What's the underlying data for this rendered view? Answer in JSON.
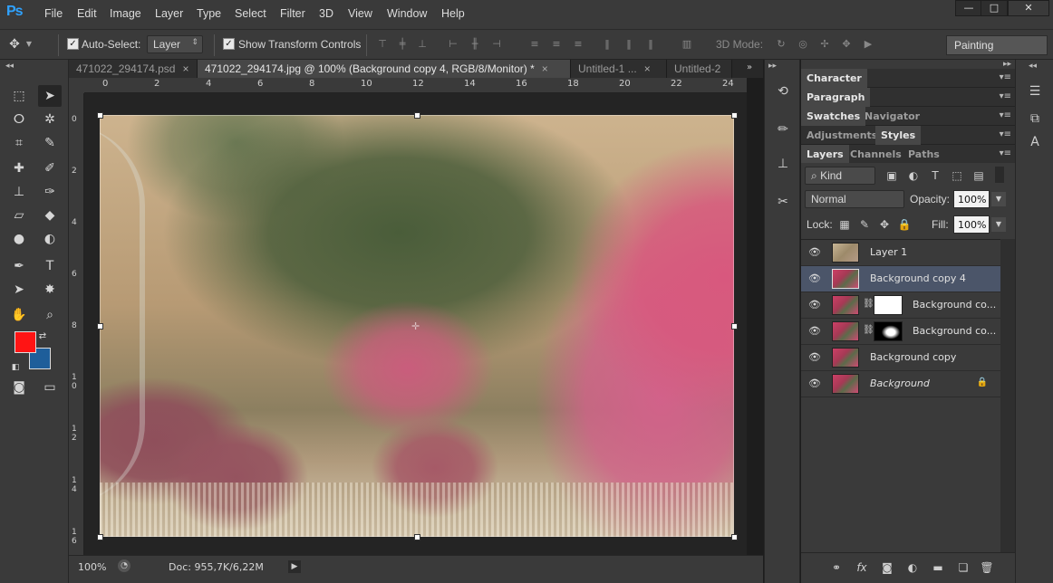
{
  "app": {
    "logo": "Ps"
  },
  "menu": [
    "File",
    "Edit",
    "Image",
    "Layer",
    "Type",
    "Select",
    "Filter",
    "3D",
    "View",
    "Window",
    "Help"
  ],
  "window_controls": {
    "minimize": "—",
    "maximize": "□",
    "close": "✕"
  },
  "options": {
    "auto_select_label": "Auto-Select:",
    "auto_select_checked": true,
    "auto_select_target": "Layer",
    "show_transform_label": "Show Transform Controls",
    "show_transform_checked": true,
    "mode_3d_label": "3D Mode:",
    "workspace": "Painting"
  },
  "doc_tabs": [
    {
      "label": "471022_294174.psd",
      "active": false,
      "close": "×"
    },
    {
      "label": "471022_294174.jpg @ 100% (Background copy 4, RGB/8/Monitor) *",
      "active": true,
      "close": "×"
    },
    {
      "label": "Untitled-1 ...",
      "active": false,
      "close": "×"
    },
    {
      "label": "Untitled-2",
      "active": false,
      "close": ""
    }
  ],
  "ruler": {
    "h_labels": [
      "0",
      "2",
      "4",
      "6",
      "8",
      "10",
      "12",
      "14",
      "16",
      "18",
      "20",
      "22",
      "24"
    ],
    "v_labels": [
      "0",
      "2",
      "4",
      "6",
      "8",
      "10",
      "12",
      "14",
      "16"
    ]
  },
  "colors": {
    "foreground": "#ff1414",
    "background": "#1e5e9a",
    "selected_layer": "#4b5569"
  },
  "status": {
    "zoom": "100%",
    "doc": "Doc: 955,7K/6,22M"
  },
  "panels": {
    "row1": {
      "tabs": [
        "Character"
      ]
    },
    "row2": {
      "tabs": [
        "Paragraph"
      ]
    },
    "row3": {
      "tabs": [
        "Swatches",
        "Navigator"
      ],
      "active": "Swatches"
    },
    "row4": {
      "tabs": [
        "Adjustments",
        "Styles"
      ],
      "active": "Styles"
    },
    "row5": {
      "tabs": [
        "Layers",
        "Channels",
        "Paths"
      ],
      "active": "Layers"
    }
  },
  "layers_panel": {
    "filter_kind": "Kind",
    "blend_mode": "Normal",
    "opacity_label": "Opacity:",
    "opacity_value": "100%",
    "lock_label": "Lock:",
    "fill_label": "Fill:",
    "fill_value": "100%",
    "layers": [
      {
        "name": "Layer 1",
        "selected": false,
        "mask": "",
        "italic": false,
        "locked": false
      },
      {
        "name": "Background copy 4",
        "selected": true,
        "mask": "",
        "italic": false,
        "locked": false
      },
      {
        "name": "Background co...",
        "selected": false,
        "mask": "white",
        "italic": false,
        "locked": false
      },
      {
        "name": "Background co...",
        "selected": false,
        "mask": "dark",
        "italic": false,
        "locked": false
      },
      {
        "name": "Background copy",
        "selected": false,
        "mask": "",
        "italic": false,
        "locked": false
      },
      {
        "name": "Background",
        "selected": false,
        "mask": "",
        "italic": true,
        "locked": true
      }
    ]
  }
}
